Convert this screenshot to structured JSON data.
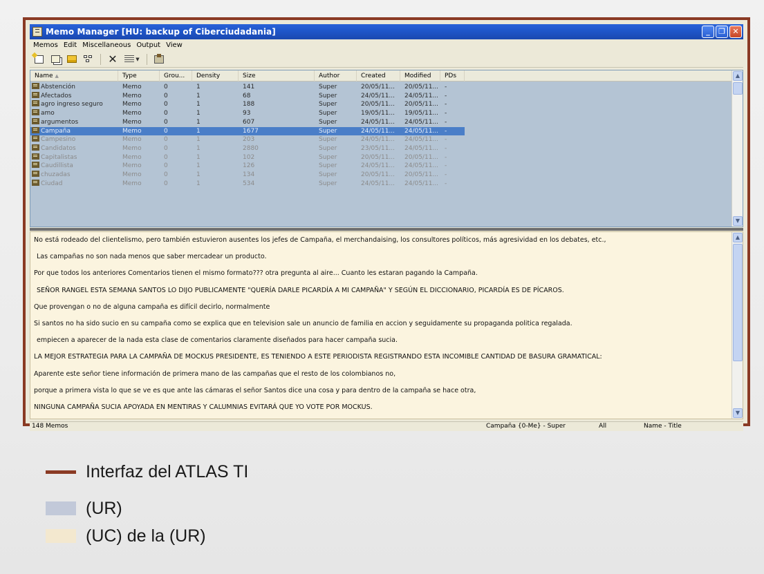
{
  "window": {
    "title": "Memo Manager [HU: backup of Ciberciudadania]",
    "border_color": "#8a3a24",
    "buttons": [
      "minimize-icon",
      "restore-icon",
      "close-icon"
    ]
  },
  "menu": [
    "Memos",
    "Edit",
    "Miscellaneous",
    "Output",
    "View"
  ],
  "toolbar": {
    "icons": [
      "new-memo-icon",
      "duplicate-memo-icon",
      "memo-folder-icon",
      "network-icon",
      "delete-icon",
      "list-view-icon",
      "export-icon"
    ]
  },
  "list": {
    "columns": [
      "Name",
      "Type",
      "Grou...",
      "Density",
      "Size",
      "Author",
      "Created",
      "Modified",
      "PDs"
    ],
    "sort_indicator": "▲",
    "rows": [
      {
        "name": "Abstención",
        "type": "Memo",
        "grou": "0",
        "density": "1",
        "size": "141",
        "author": "Super",
        "created": "20/05/11...",
        "modified": "20/05/11...",
        "pds": "-"
      },
      {
        "name": "Afectados",
        "type": "Memo",
        "grou": "0",
        "density": "1",
        "size": "68",
        "author": "Super",
        "created": "24/05/11...",
        "modified": "24/05/11...",
        "pds": "-"
      },
      {
        "name": "agro ingreso seguro",
        "type": "Memo",
        "grou": "0",
        "density": "1",
        "size": "188",
        "author": "Super",
        "created": "20/05/11...",
        "modified": "20/05/11...",
        "pds": "-"
      },
      {
        "name": "amo",
        "type": "Memo",
        "grou": "0",
        "density": "1",
        "size": "93",
        "author": "Super",
        "created": "19/05/11...",
        "modified": "19/05/11...",
        "pds": "-"
      },
      {
        "name": "argumentos",
        "type": "Memo",
        "grou": "0",
        "density": "1",
        "size": "607",
        "author": "Super",
        "created": "24/05/11...",
        "modified": "24/05/11...",
        "pds": "-"
      },
      {
        "name": "Campaña",
        "type": "Memo",
        "grou": "0",
        "density": "1",
        "size": "1677",
        "author": "Super",
        "created": "24/05/11...",
        "modified": "24/05/11...",
        "pds": "-"
      },
      {
        "name": "Campesino",
        "type": "Memo",
        "grou": "0",
        "density": "1",
        "size": "203",
        "author": "Super",
        "created": "24/05/11...",
        "modified": "24/05/11...",
        "pds": "-"
      },
      {
        "name": "Candidatos",
        "type": "Memo",
        "grou": "0",
        "density": "1",
        "size": "2880",
        "author": "Super",
        "created": "23/05/11...",
        "modified": "24/05/11...",
        "pds": "-"
      },
      {
        "name": "Capitalistas",
        "type": "Memo",
        "grou": "0",
        "density": "1",
        "size": "102",
        "author": "Super",
        "created": "20/05/11...",
        "modified": "20/05/11...",
        "pds": "-"
      },
      {
        "name": "Caudillista",
        "type": "Memo",
        "grou": "0",
        "density": "1",
        "size": "126",
        "author": "Super",
        "created": "24/05/11...",
        "modified": "24/05/11...",
        "pds": "-"
      },
      {
        "name": "chuzadas",
        "type": "Memo",
        "grou": "0",
        "density": "1",
        "size": "134",
        "author": "Super",
        "created": "20/05/11...",
        "modified": "20/05/11...",
        "pds": "-"
      },
      {
        "name": "Ciudad",
        "type": "Memo",
        "grou": "0",
        "density": "1",
        "size": "534",
        "author": "Super",
        "created": "24/05/11...",
        "modified": "24/05/11...",
        "pds": "-"
      }
    ],
    "selected_row": "Campaña",
    "background_color": "#b4c4d4"
  },
  "memo_text": {
    "background_color": "#fbf4df",
    "lines": [
      "No está rodeado del clientelismo, pero también estuvieron ausentes los jefes de Campaña, el merchandaising, los consultores políticos, más agresividad en los debates, etc.,",
      "Las campañas no son nada menos que saber mercadear un producto.",
      "Por que todos los anteriores Comentarios tienen el mismo formato??? otra pregunta al aire... Cuanto les estaran pagando la Campaña.",
      "SEÑOR RANGEL ESTA SEMANA SANTOS LO DIJO PUBLICAMENTE \"QUERÍA DARLE PICARDÍA A MI CAMPAÑA\" Y SEGÚN EL DICCIONARIO, PICARDÍA ES DE PÍCAROS.",
      "Que provengan o no de alguna campaña es difícil decirlo, normalmente",
      "Si santos no ha sido sucio en su campaña como se explica que en television sale un anuncio de familia en accion y seguidamente su propaganda politica regalada.",
      "empiecen a aparecer de la nada esta clase de comentarios claramente diseñados para hacer campaña sucia.",
      "LA MEJOR ESTRATEGIA PARA LA CAMPAÑA DE MOCKUS PRESIDENTE, ES TENIENDO A ESTE PERIODISTA REGISTRANDO ESTA INCOMIBLE CANTIDAD DE BASURA GRAMATICAL:",
      "Aparente este señor tiene información de primera mano de las campañas que el resto de los colombianos no,",
      "porque a primera vista lo que se ve es que ante las cámaras el señor Santos dice una cosa y para dentro de la campaña se hace otra,",
      "NINGUNA CAMPAÑA SUCIA APOYADA EN MENTIRAS Y CALUMNIAS EVITARÁ QUE YO VOTE POR MOCKUS."
    ]
  },
  "status": {
    "count": "148 Memos",
    "current": "Campaña {0-Me} - Super",
    "filter": "All",
    "sort": "Name - Title"
  },
  "legend": [
    {
      "label": "Interfaz del ATLAS TI",
      "color": "#8a3a24",
      "kind": "line"
    },
    {
      "label": "(UR)",
      "color": "#c2c9d9",
      "kind": "box"
    },
    {
      "label": "(UC) de la (UR)",
      "color": "#f3e8cf",
      "kind": "box"
    }
  ]
}
